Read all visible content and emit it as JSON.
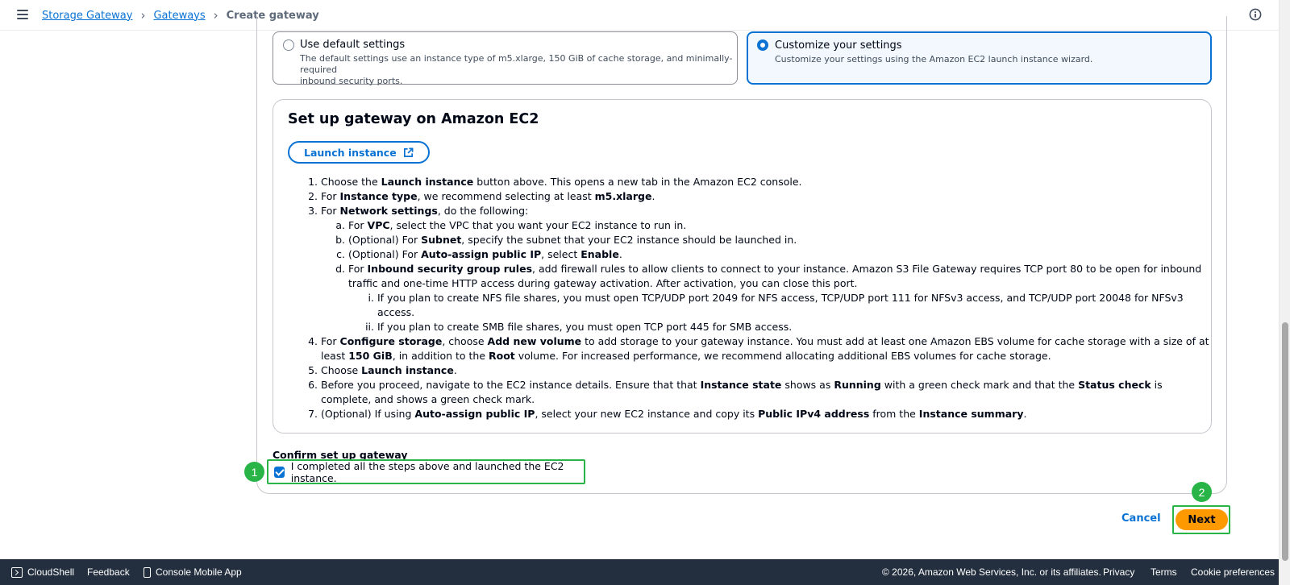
{
  "breadcrumb": {
    "items": [
      "Storage Gateway",
      "Gateways"
    ],
    "current": "Create gateway"
  },
  "options": {
    "default": {
      "label": "Use default settings",
      "desc_line1": "The default settings use an instance type of m5.xlarge, 150 GiB of cache storage, and minimally-required",
      "desc_line2": "inbound security ports."
    },
    "custom": {
      "label": "Customize your settings",
      "desc": "Customize your settings using the Amazon EC2 launch instance wizard.",
      "selected": true
    }
  },
  "setup": {
    "title": "Set up gateway on Amazon EC2",
    "launch_button": "Launch instance",
    "steps": {
      "s1": {
        "num": "1.",
        "t1": "Choose the ",
        "b1": "Launch instance",
        "t2": " button above. This opens a new tab in the Amazon EC2 console."
      },
      "s2": {
        "num": "2.",
        "t1": "For ",
        "b1": "Instance type",
        "t2": ", we recommend selecting at least ",
        "b2": "m5.xlarge",
        "t3": "."
      },
      "s3": {
        "num": "3.",
        "t1": "For ",
        "b1": "Network settings",
        "t2": ", do the following:",
        "a": {
          "num": "a.",
          "t1": "For ",
          "b1": "VPC",
          "t2": ", select the VPC that you want your EC2 instance to run in."
        },
        "b": {
          "num": "b.",
          "t1": "(Optional) For ",
          "b1": "Subnet",
          "t2": ", specify the subnet that your EC2 instance should be launched in."
        },
        "c": {
          "num": "c.",
          "t1": "(Optional) For ",
          "b1": "Auto-assign public IP",
          "t2": ", select ",
          "b2": "Enable",
          "t3": "."
        },
        "d": {
          "num": "d.",
          "t1": "For ",
          "b1": "Inbound security group rules",
          "t2": ", add firewall rules to allow clients to connect to your instance. Amazon S3 File Gateway requires TCP port 80 to be open for inbound traffic and one-time HTTP access during gateway activation. After activation, you can close this port.",
          "i": {
            "num": "i.",
            "text": "If you plan to create NFS file shares, you must open TCP/UDP port 2049 for NFS access, TCP/UDP port 111 for NFSv3 access, and TCP/UDP port 20048 for NFSv3 access."
          },
          "ii": {
            "num": "ii.",
            "text": "If you plan to create SMB file shares, you must open TCP port 445 for SMB access."
          }
        }
      },
      "s4": {
        "num": "4.",
        "t1": "For ",
        "b1": "Configure storage",
        "t2": ", choose ",
        "b2": "Add new volume",
        "t3": " to add storage to your gateway instance. You must add at least one Amazon EBS volume for cache storage with a size of at least ",
        "b3": "150 GiB",
        "t4": ", in addition to the ",
        "b4": "Root",
        "t5": " volume. For increased performance, we recommend allocating additional EBS volumes for cache storage."
      },
      "s5": {
        "num": "5.",
        "t1": "Choose ",
        "b1": "Launch instance",
        "t2": "."
      },
      "s6": {
        "num": "6.",
        "t1": "Before you proceed, navigate to the EC2 instance details. Ensure that that ",
        "b1": "Instance state",
        "t2": " shows as ",
        "b2": "Running",
        "t3": " with a green check mark and that the ",
        "b3": "Status check",
        "t4": " is complete, and shows a green check mark."
      },
      "s7": {
        "num": "7.",
        "t1": "(Optional) If using ",
        "b1": "Auto-assign public IP",
        "t2": ", select your new EC2 instance and copy its ",
        "b2": "Public IPv4 address",
        "t3": " from the ",
        "b3": "Instance summary",
        "t4": "."
      }
    }
  },
  "confirm": {
    "heading": "Confirm set up gateway",
    "checkbox_label": "I completed all the steps above and launched the EC2 instance.",
    "checked": true
  },
  "markers": {
    "m1": "1",
    "m2": "2"
  },
  "actions": {
    "cancel": "Cancel",
    "next": "Next"
  },
  "footer": {
    "cloudshell": "CloudShell",
    "feedback": "Feedback",
    "mobile_app": "Console Mobile App",
    "copyright": "© 2026, Amazon Web Services, Inc. or its affiliates.",
    "privacy": "Privacy",
    "terms": "Terms",
    "cookies": "Cookie preferences"
  },
  "colors": {
    "link": "#0972d3",
    "primary_button": "#ff9900",
    "highlight": "#28b446",
    "footer_bg": "#232f3e"
  },
  "icons": [
    "menu-icon",
    "chevron-right-icon",
    "info-icon",
    "external-link-icon",
    "terminal-icon",
    "mobile-icon"
  ]
}
